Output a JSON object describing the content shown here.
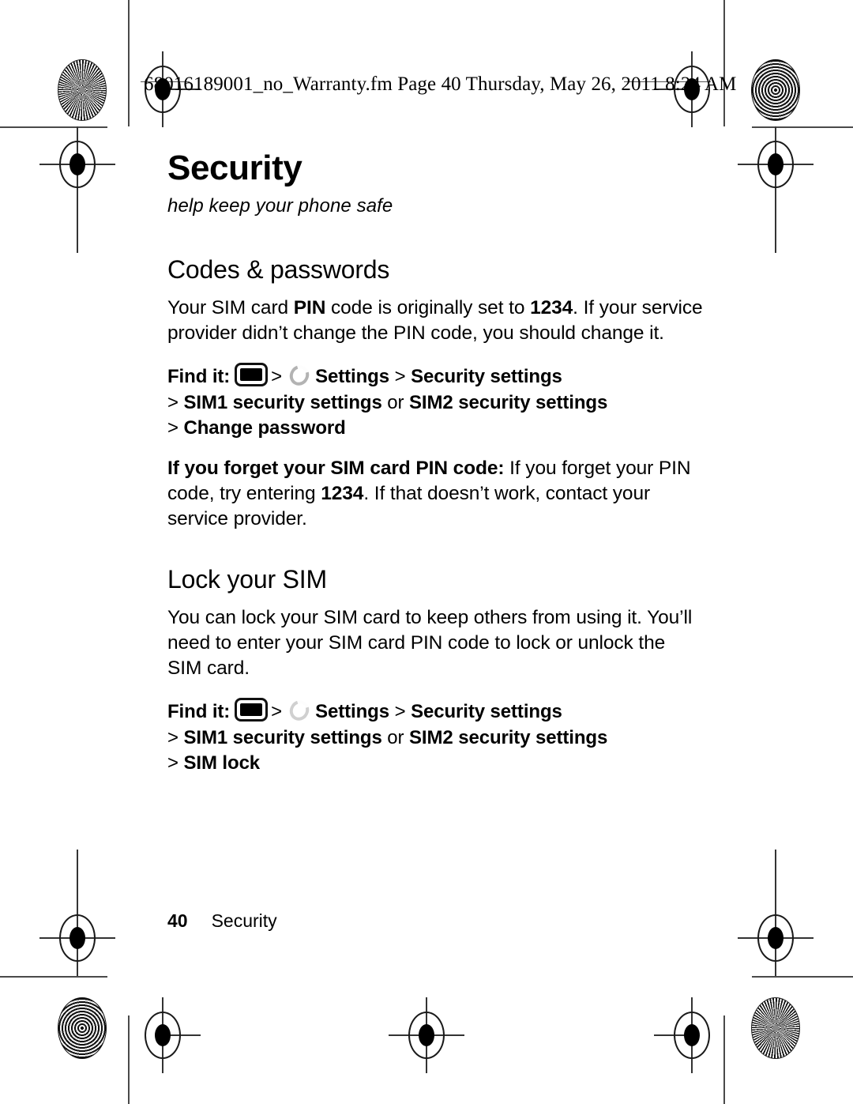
{
  "print_header": {
    "slug": "68016189001_no_Warranty.fm  Page 40  Thursday, May 26, 2011  8:24 AM"
  },
  "page": {
    "chapter_title": "Security",
    "chapter_subtitle": "help keep your phone safe",
    "sections": [
      {
        "heading": "Codes & passwords",
        "paragraph_1_a": "Your SIM card ",
        "paragraph_1_b": "PIN",
        "paragraph_1_c": " code is originally set to ",
        "paragraph_1_d": "1234",
        "paragraph_1_e": ". If your service provider didn’t change the PIN code, you should change it.",
        "findit": {
          "label": "Find it:",
          "menu_icon_name": "menu-key-icon",
          "settings_icon_name": "settings-icon",
          "chevron_1": ">",
          "settings_label": "Settings",
          "chevron_2": ">",
          "security_settings_label": "Security settings",
          "chevron_3": ">",
          "sim1_label": "SIM1 security settings",
          "or_label": "or",
          "sim2_label": "SIM2 security settings",
          "chevron_4": ">",
          "final_label": "Change password"
        },
        "paragraph_2_a": "If you forget your SIM card PIN code:",
        "paragraph_2_b": " If you forget your PIN code, try entering ",
        "paragraph_2_c": "1234",
        "paragraph_2_d": ". If that doesn’t work, contact your service provider."
      },
      {
        "heading": "Lock your SIM",
        "paragraph_1": "You can lock your SIM card to keep others from using it. You’ll need to enter your SIM card PIN code to lock or unlock the SIM card.",
        "findit": {
          "label": "Find it:",
          "menu_icon_name": "menu-key-icon",
          "settings_icon_name": "settings-icon",
          "chevron_1": ">",
          "settings_label": "Settings",
          "chevron_2": ">",
          "security_settings_label": "Security settings",
          "chevron_3": ">",
          "sim1_label": "SIM1 security settings",
          "or_label": "or",
          "sim2_label": "SIM2 security settings",
          "chevron_4": ">",
          "final_label": "SIM lock"
        }
      }
    ]
  },
  "footer": {
    "page_number": "40",
    "chapter_name": "Security"
  },
  "colors": {
    "text": "#000000",
    "settings_icon_gray": "#b3b3b3",
    "crop_mark_gray": "#4a4a4a",
    "background": "#ffffff"
  }
}
